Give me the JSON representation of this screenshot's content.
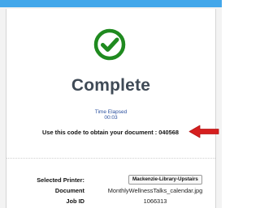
{
  "status": {
    "title": "Complete",
    "icon": "check-circle-icon",
    "icon_color": "#1f8a1f"
  },
  "elapsed": {
    "label": "Time Elapsed",
    "value": "00:03"
  },
  "code": {
    "text": "Use this code to obtain your document : 040568"
  },
  "details": {
    "printer_label": "Selected Printer:",
    "printer_value": "Mackenzie-Library-Upstairs",
    "document_label": "Document",
    "document_value": "MonthlyWellnessTalks_calendar.jpg",
    "jobid_label": "Job ID",
    "jobid_value": "1066313"
  },
  "colors": {
    "top_bar": "#43a7ea",
    "arrow": "#d61f1f",
    "title": "#3f4a56",
    "elapsed_text": "#2a4f9e"
  }
}
